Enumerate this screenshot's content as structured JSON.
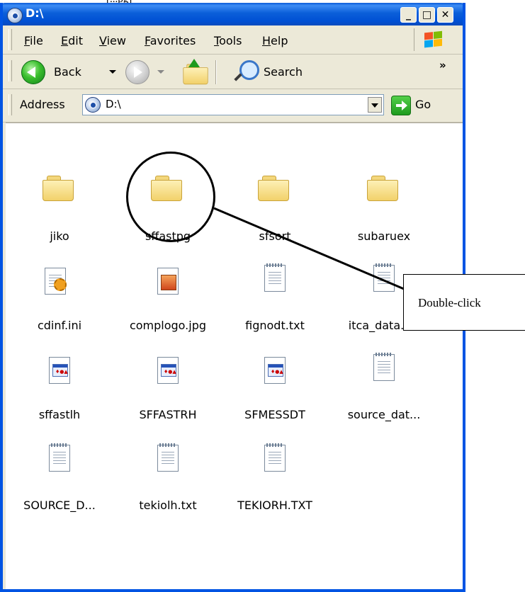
{
  "window": {
    "title": "D:\\",
    "buttons": {
      "minimize": "_",
      "maximize": "□",
      "close": "✕"
    }
  },
  "menu": [
    "File",
    "Edit",
    "View",
    "Favorites",
    "Tools",
    "Help"
  ],
  "toolbar": {
    "back_label": "Back",
    "search_label": "Search",
    "overflow": "»"
  },
  "address": {
    "label": "Address",
    "value": "D:\\",
    "go_label": "Go"
  },
  "files": [
    {
      "name": "jiko",
      "type": "folder"
    },
    {
      "name": "sffastpg",
      "type": "folder"
    },
    {
      "name": "sfsort",
      "type": "folder"
    },
    {
      "name": "subaruex",
      "type": "folder"
    },
    {
      "name": "cdinf.ini",
      "type": "ini"
    },
    {
      "name": "complogo.jpg",
      "type": "image"
    },
    {
      "name": "fignodt.txt",
      "type": "text"
    },
    {
      "name": "itca_data.txt",
      "type": "text"
    },
    {
      "name": "sffastlh",
      "type": "app"
    },
    {
      "name": "SFFASTRH",
      "type": "app"
    },
    {
      "name": "SFMESSDT",
      "type": "app"
    },
    {
      "name": "source_dat...",
      "type": "text"
    },
    {
      "name": "SOURCE_D...",
      "type": "text"
    },
    {
      "name": "tekiolh.txt",
      "type": "text"
    },
    {
      "name": "TEKIORH.TXT",
      "type": "text"
    }
  ],
  "annotation": {
    "callout_text": "Double-click",
    "top_caption": "[...pg]"
  },
  "colors": {
    "titlebar": "#0054e3",
    "chrome": "#ece9d8",
    "folder": "#f2d16a",
    "go_green": "#1e9b1e"
  }
}
